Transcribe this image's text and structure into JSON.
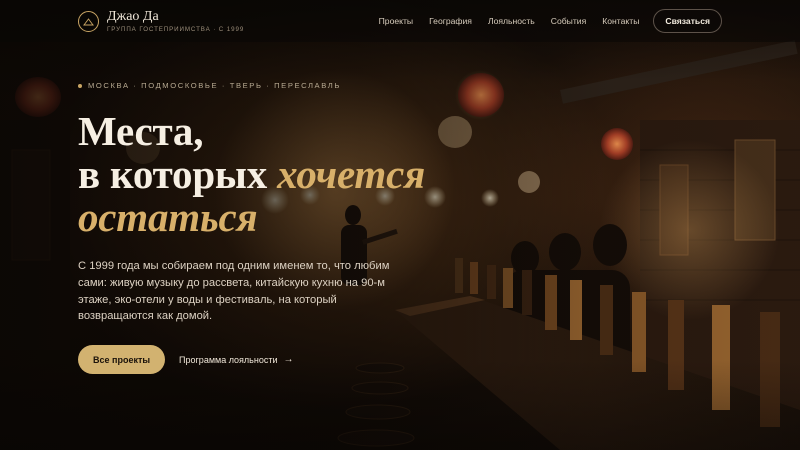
{
  "brand": {
    "name": "Джао Да",
    "tagline": "ГРУППА ГОСТЕПРИИМСТВА · С 1999"
  },
  "nav": {
    "items": [
      {
        "label": "Проекты"
      },
      {
        "label": "География"
      },
      {
        "label": "Лояльность"
      },
      {
        "label": "События"
      },
      {
        "label": "Контакты"
      }
    ],
    "contact_label": "Связаться"
  },
  "hero": {
    "eyebrow": "МОСКВА · ПОДМОСКОВЬЕ · ТВЕРЬ · ПЕРЕСЛАВЛЬ",
    "headline": {
      "line1": "Места,",
      "line2": "в которых",
      "accent1": "хочется",
      "accent2": "остаться"
    },
    "lead": "С 1999 года мы собираем под одним именем то, что любим сами: живую музыку до рассвета, китайскую кухню на 90-м этаже, эко-отели у воды и фестиваль, на который возвращаются как домой.",
    "primary_cta": "Все проекты",
    "secondary_cta": "Программа лояльности",
    "secondary_arrow": "→"
  },
  "colors": {
    "accent": "#d2b270",
    "accent_text": "#d8b06a",
    "background": "#0d0906"
  }
}
